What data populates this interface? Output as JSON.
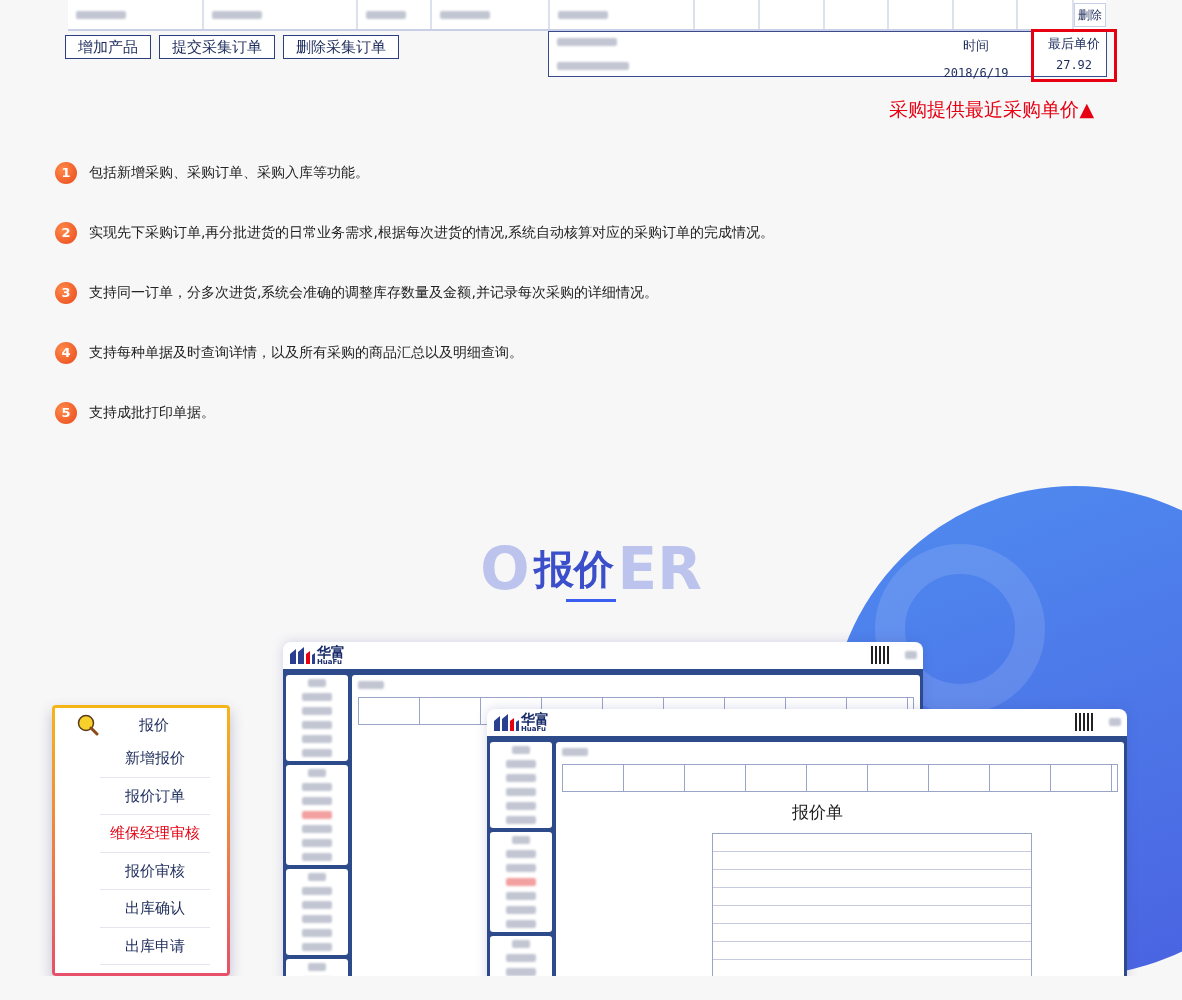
{
  "top_table": {
    "delete_button": "删除"
  },
  "buttons": [
    "增加产品",
    "提交采集订单",
    "删除采集订单"
  ],
  "price_panel": {
    "columns": [
      "时间",
      "最后单价"
    ],
    "value_row": [
      "2018/6/19",
      "27.92"
    ]
  },
  "caption": "采购提供最近采购单价▲",
  "features": [
    {
      "number": "1",
      "text": "包括新增采购、采购订单、采购入库等功能。"
    },
    {
      "number": "2",
      "text": "实现先下采购订单,再分批进货的日常业务需求,根据每次进货的情况,系统自动核算对应的采购订单的完成情况。"
    },
    {
      "number": "3",
      "text": "支持同一订单，分多次进货,系统会准确的调整库存数量及金额,并记录每次采购的详细情况。"
    },
    {
      "number": "4",
      "text": "支持每种单据及时查询详情，以及所有采购的商品汇总以及明细查询。"
    },
    {
      "number": "5",
      "text": "支持成批打印单据。"
    }
  ],
  "section": {
    "backdrop_letters": [
      "O",
      "ER"
    ],
    "title": "报价"
  },
  "screenshots": [
    {
      "logo": "华富",
      "logo_sub": "HuaFu"
    },
    {
      "logo": "华富",
      "logo_sub": "HuaFu",
      "doc_title": "报价单"
    }
  ],
  "menu": {
    "title": "报价",
    "items": [
      {
        "label": "新增报价",
        "selected": false
      },
      {
        "label": "报价订单",
        "selected": false
      },
      {
        "label": "维保经理审核",
        "selected": true
      },
      {
        "label": "报价审核",
        "selected": false
      },
      {
        "label": "出库确认",
        "selected": false
      },
      {
        "label": "出库申请",
        "selected": false
      }
    ]
  }
}
